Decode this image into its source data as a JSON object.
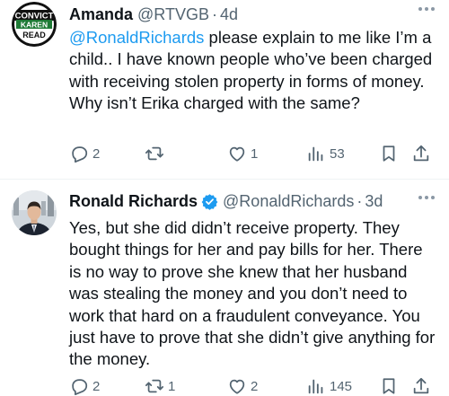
{
  "tweets": [
    {
      "name": "Amanda",
      "handle": "@RTVGB",
      "separator": "·",
      "time": "4d",
      "avatar_text": [
        "CONVICT",
        "KAREN",
        "READ"
      ],
      "mention": "@RonaldRichards",
      "text": " please explain to me like I’m a child.. I have known people who’ve been charged with receiving stolen property in forms of money. Why isn’t Erika charged with the same?",
      "replies": "2",
      "reposts": "",
      "likes": "1",
      "views": "53",
      "verified": false
    },
    {
      "name": "Ronald Richards",
      "handle": "@RonaldRichards",
      "separator": "·",
      "time": "3d",
      "text": "Yes, but she did didn’t receive property. They bought things for her and pay bills for her. There is no way to prove she knew that her husband was stealing the money and you don’t need to work that hard on a fraudulent conveyance. You just have to prove that she didn’t give anything for the money.",
      "replies": "2",
      "reposts": "1",
      "likes": "2",
      "views": "145",
      "verified": true
    }
  ],
  "colors": {
    "accent": "#1d9bf0",
    "secondary_text": "#536471",
    "avatar_green": "#1e7a35"
  },
  "icons": [
    "reply-icon",
    "repost-icon",
    "like-icon",
    "views-icon",
    "bookmark-icon",
    "share-icon",
    "more-icon",
    "verified-badge-icon"
  ]
}
